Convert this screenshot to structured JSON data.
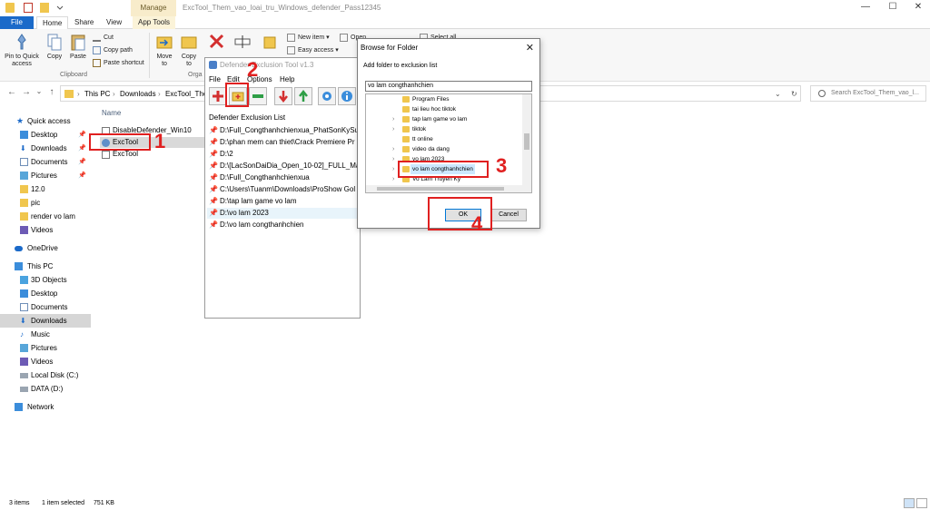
{
  "window": {
    "title": "ExcTool_Them_vao_loai_tru_Windows_defender_Pass12345",
    "manage_tab": "Manage",
    "controls": [
      "—",
      "☐",
      "✕"
    ]
  },
  "ribbon_tabs": {
    "file": "File",
    "home": "Home",
    "share": "Share",
    "view": "View",
    "app_tools": "App Tools"
  },
  "ribbon": {
    "pin": "Pin to Quick access",
    "copy": "Copy",
    "paste": "Paste",
    "cut": "Cut",
    "copy_path": "Copy path",
    "paste_shortcut": "Paste shortcut",
    "clipboard_label": "Clipboard",
    "move_to": "Move to",
    "copy_to": "Copy to",
    "organize_label": "Orga",
    "new_item": "New item",
    "easy_access": "Easy access",
    "open": "Open",
    "select_all": "Select all"
  },
  "address": {
    "this_pc": "This PC",
    "downloads": "Downloads",
    "folder": "ExcTool_Them",
    "search_placeholder": "Search ExcTool_Them_vao_l..."
  },
  "nav": {
    "quick_access": "Quick access",
    "desktop": "Desktop",
    "downloads": "Downloads",
    "documents": "Documents",
    "pictures": "Pictures",
    "f_12": "12.0",
    "pic": "pic",
    "render": "render vo lam",
    "videos": "Videos",
    "onedrive": "OneDrive",
    "this_pc": "This PC",
    "objects3d": "3D Objects",
    "pc_desktop": "Desktop",
    "pc_documents": "Documents",
    "pc_downloads": "Downloads",
    "music": "Music",
    "pc_pictures": "Pictures",
    "pc_videos": "Videos",
    "local_disk": "Local Disk (C:)",
    "data_disk": "DATA (D:)",
    "network": "Network"
  },
  "files": {
    "column_name": "Name",
    "items": [
      "DisableDefender_Win10",
      "ExcTool",
      "ExcTool"
    ]
  },
  "defender_tool": {
    "title": "Defender Exclusion Tool v1.3",
    "menu": [
      "File",
      "Edit",
      "Options",
      "Help"
    ],
    "list_label": "Defender Exclusion List",
    "entries": [
      "D:\\Full_Congthanhchienxua_PhatSonKySu",
      "D:\\phan mem can thiet\\Crack Premiere Pr",
      "D:\\2",
      "D:\\[LacSonDaiDia_Open_10-02]_FULL_Ma",
      "D:\\Full_Congthanhchienxua",
      "C:\\Users\\Tuanm\\Downloads\\ProShow Gol",
      "D:\\tap lam game vo lam",
      "D:\\vo lam 2023",
      "D:\\vo lam congthanhchien"
    ]
  },
  "browse_dialog": {
    "title": "Browse for Folder",
    "close": "✕",
    "description": "Add folder to exclusion list",
    "input_value": "vo lam congthanhchien",
    "tree": [
      "Program Files",
      "tai lieu hoc tiktok",
      "tap lam game vo lam",
      "tiktok",
      "tt online",
      "video da dang",
      "vo lam 2023",
      "vo lam congthanhchien",
      "Vo Lam Truyen Ky"
    ],
    "ok": "OK",
    "cancel": "Cancel"
  },
  "annotations": [
    "1",
    "2",
    "3",
    "4"
  ],
  "status": {
    "items": "3 items",
    "selected": "1 item selected",
    "size": "751 KB"
  },
  "colors": {
    "accent": "#1b6ac9",
    "annotation_red": "#e02020",
    "folder": "#f0c64e"
  }
}
